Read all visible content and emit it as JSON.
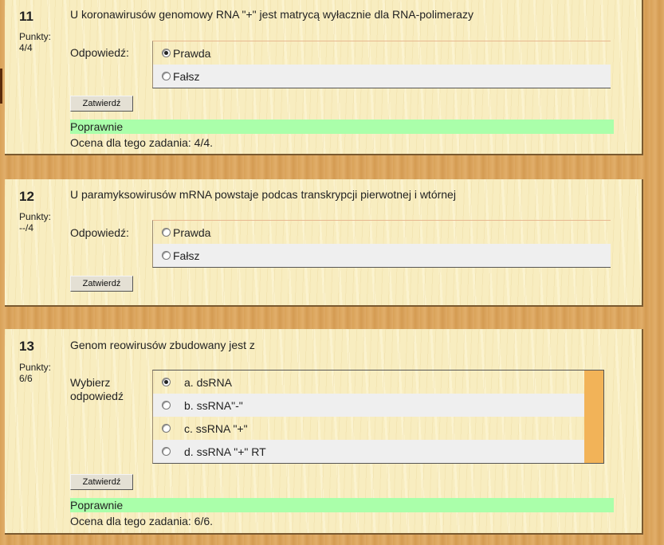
{
  "questions": [
    {
      "number": "11",
      "points_label": "Punkty:",
      "points": "4/4",
      "text": "U koronawirusów genomowy RNA \"+\" jest matrycą wyłacznie dla RNA-polimerazy",
      "answer_label": "Odpowiedź:",
      "options": [
        {
          "label": "Prawda",
          "selected": true
        },
        {
          "label": "Fałsz",
          "selected": false
        }
      ],
      "submit_label": "Zatwierdź",
      "feedback": "Poprawnie",
      "grade": "Ocena dla tego zadania: 4/4."
    },
    {
      "number": "12",
      "points_label": "Punkty:",
      "points": "--/4",
      "text": "U paramyksowirusów mRNA powstaje podcas transkrypcji pierwotnej i wtórnej",
      "answer_label": "Odpowiedź:",
      "options": [
        {
          "label": "Prawda",
          "selected": false
        },
        {
          "label": "Fałsz",
          "selected": false
        }
      ],
      "submit_label": "Zatwierdź"
    },
    {
      "number": "13",
      "points_label": "Punkty:",
      "points": "6/6",
      "text": "Genom reowirusów zbudowany jest z",
      "answer_label_line1": "Wybierz",
      "answer_label_line2": "odpowiedź",
      "options": [
        {
          "label": "a. dsRNA",
          "selected": true
        },
        {
          "label": "b. ssRNA\"-\"",
          "selected": false
        },
        {
          "label": "c. ssRNA \"+\"",
          "selected": false
        },
        {
          "label": "d. ssRNA \"+\" RT",
          "selected": false
        }
      ],
      "submit_label": "Zatwierdź",
      "feedback": "Poprawnie",
      "grade": "Ocena dla tego zadania: 6/6."
    }
  ],
  "colors": {
    "page_background": "#d9a259",
    "card_background": "#f8edc0",
    "feedback_correct": "#aaffaa",
    "scrollbar": "#f2b358"
  }
}
